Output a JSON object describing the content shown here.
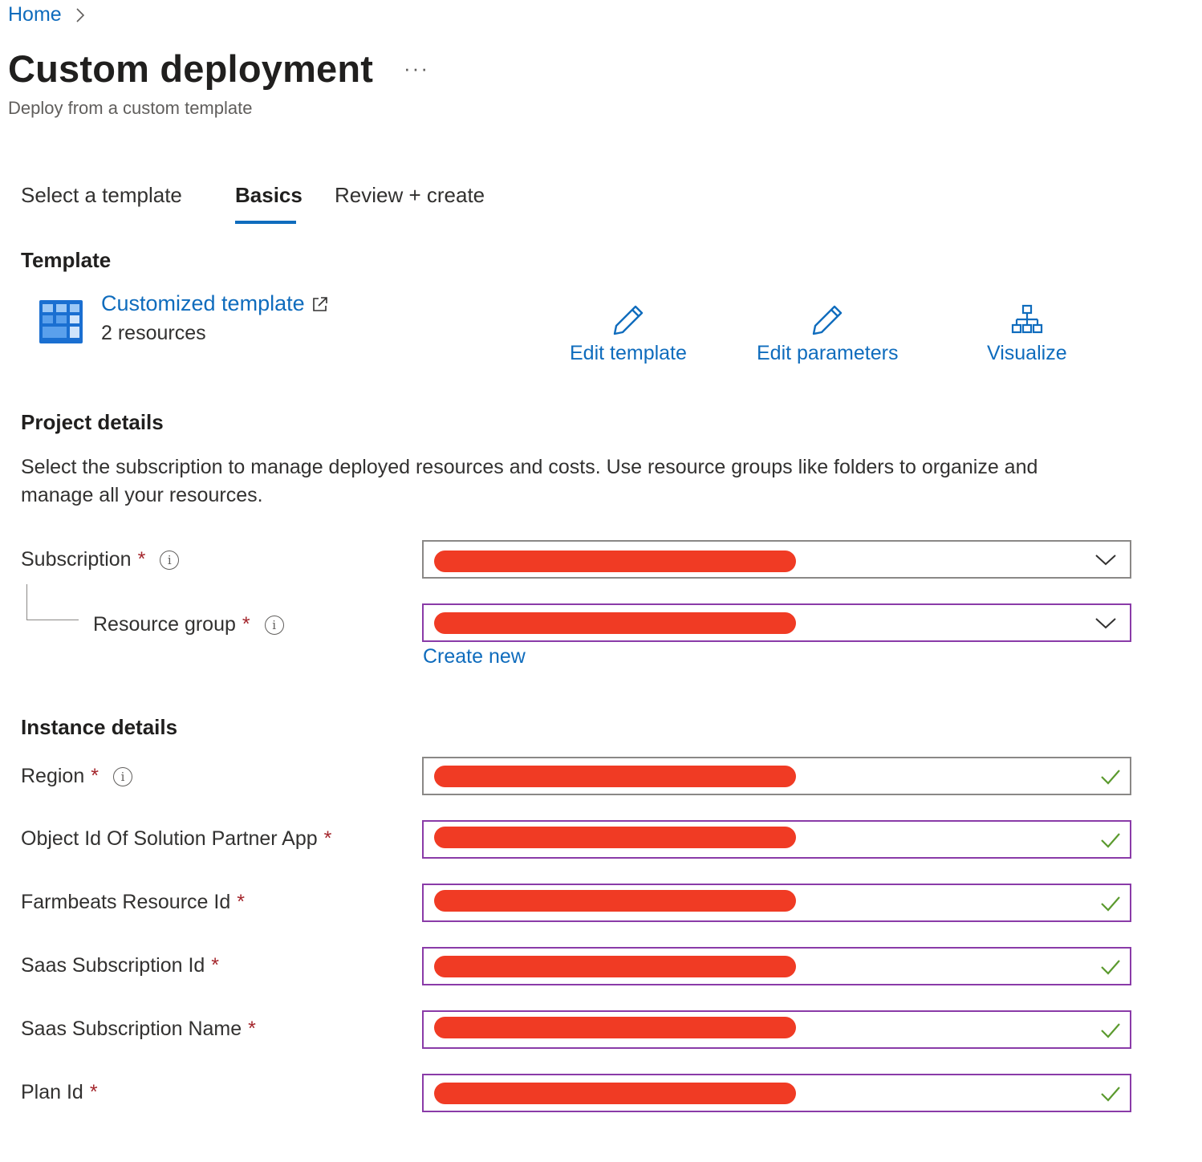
{
  "breadcrumb": {
    "home": "Home"
  },
  "header": {
    "title": "Custom deployment",
    "more": "···",
    "subtitle": "Deploy from a custom template"
  },
  "tabs": [
    {
      "label": "Select a template",
      "active": false
    },
    {
      "label": "Basics",
      "active": true
    },
    {
      "label": "Review + create",
      "active": false
    }
  ],
  "template": {
    "heading": "Template",
    "name": "Customized template",
    "resources": "2 resources",
    "actions": {
      "edit_template": "Edit template",
      "edit_parameters": "Edit parameters",
      "visualize": "Visualize"
    }
  },
  "project": {
    "heading": "Project details",
    "description": "Select the subscription to manage deployed resources and costs. Use resource groups like folders to organize and manage all your resources.",
    "subscription_label": "Subscription",
    "resource_group_label": "Resource group",
    "create_new": "Create new"
  },
  "instance": {
    "heading": "Instance details",
    "fields": [
      {
        "label": "Region",
        "required_mark": "*",
        "info": true
      },
      {
        "label": "Object Id Of Solution Partner App",
        "required_mark": "*"
      },
      {
        "label": "Farmbeats Resource Id",
        "required_mark": "*"
      },
      {
        "label": "Saas Subscription Id",
        "required_mark": "*"
      },
      {
        "label": "Saas Subscription Name",
        "required_mark": "*"
      },
      {
        "label": "Plan Id",
        "required_mark": "*"
      }
    ]
  },
  "required_mark": "*",
  "info_glyph": "i",
  "colors": {
    "link": "#0f6cbd",
    "required": "#a4262c",
    "valid_check": "#5b9a2e",
    "focused_border": "#8a3ba8",
    "redaction": "#f03b24"
  }
}
